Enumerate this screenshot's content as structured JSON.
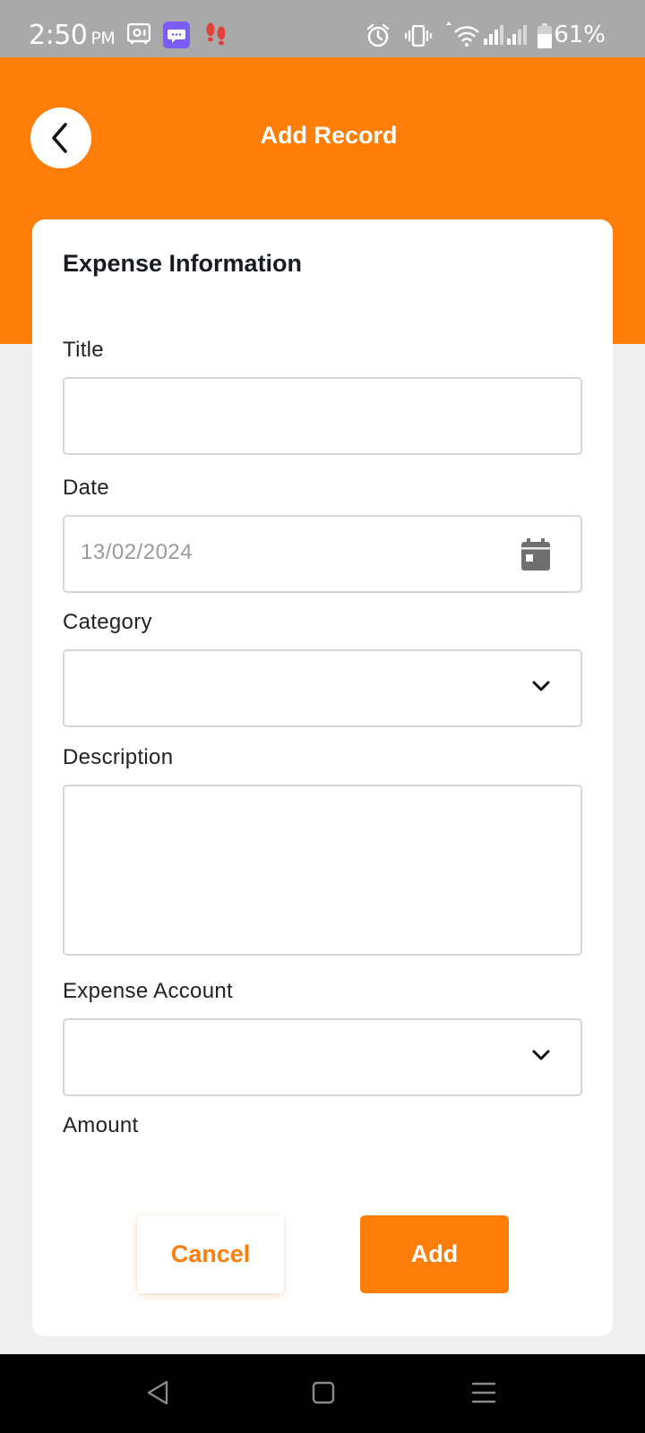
{
  "status_bar": {
    "time": "2:50",
    "ampm": "PM",
    "battery_percent": "61%"
  },
  "header": {
    "title": "Add Record",
    "back_icon": "chevron-left-icon",
    "background_color": "#ff7e0a"
  },
  "form": {
    "section_title": "Expense Information",
    "fields": {
      "title": {
        "label": "Title",
        "value": ""
      },
      "date": {
        "label": "Date",
        "value": "13/02/2024",
        "icon": "calendar-icon"
      },
      "category": {
        "label": "Category",
        "value": "",
        "icon": "chevron-down-icon"
      },
      "description": {
        "label": "Description",
        "value": ""
      },
      "expense_account": {
        "label": "Expense Account",
        "value": "",
        "icon": "chevron-down-icon"
      },
      "amount": {
        "label": "Amount"
      }
    },
    "buttons": {
      "cancel": "Cancel",
      "add": "Add"
    }
  },
  "colors": {
    "accent": "#ff7e0a",
    "page_background": "#efefef",
    "card_background": "#ffffff"
  }
}
